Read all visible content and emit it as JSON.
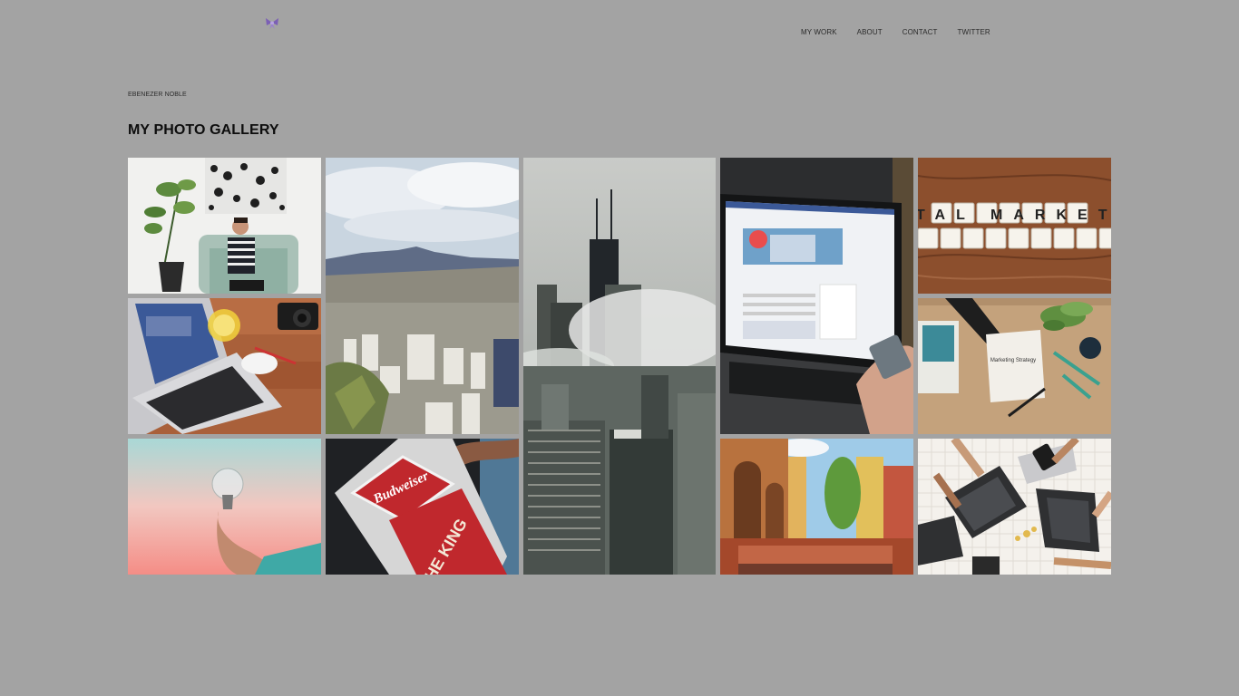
{
  "header": {
    "logo_icon": "purple-bow-logo-icon",
    "nav": [
      {
        "label": "MY WORK"
      },
      {
        "label": "ABOUT"
      },
      {
        "label": "CONTACT"
      },
      {
        "label": "TWITTER"
      }
    ]
  },
  "site_name": "EBENEZER NOBLE",
  "page_title": "MY PHOTO GALLERY",
  "gallery": {
    "photos": [
      {
        "subject": "man-with-laptop-on-couch"
      },
      {
        "subject": "mountain-city-view"
      },
      {
        "subject": "city-skyscrapers-in-fog"
      },
      {
        "subject": "laptop-facebook-screen"
      },
      {
        "subject": "digital-marketing-tiles",
        "text": "DIGITAL MARKETING"
      },
      {
        "subject": "laptop-and-camera-on-desk"
      },
      {
        "subject": "marketing-strategy-desk",
        "text": "Marketing Strategy"
      },
      {
        "subject": "hand-holding-lightbulb"
      },
      {
        "subject": "budweiser-sign",
        "text": "Budweiser",
        "text2": "THE KING"
      },
      {
        "subject": "bologna-street-arches"
      },
      {
        "subject": "team-laptops-top-view"
      }
    ]
  },
  "colors": {
    "background": "#a3a3a3",
    "title": "#0d0d0d",
    "nav_text": "#2b2b2b",
    "logo": "#7b5fb5"
  }
}
